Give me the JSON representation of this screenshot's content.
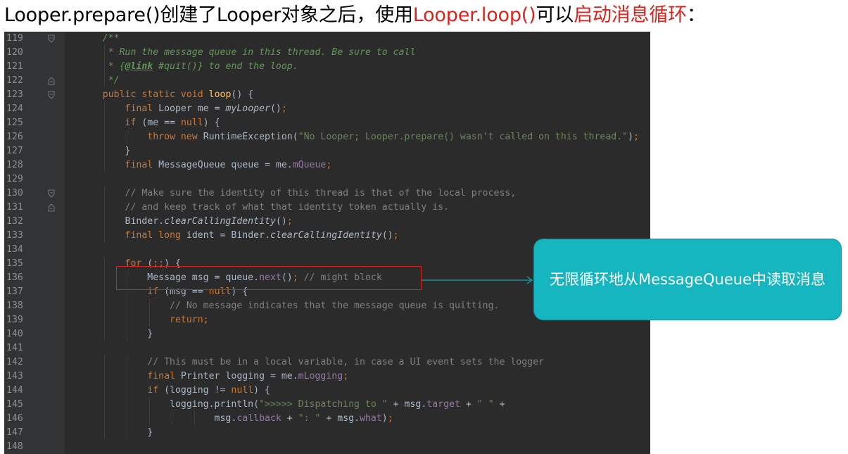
{
  "heading": {
    "part1": "Looper.prepare()创建了Looper对象之后，使用",
    "part2": "Looper.loop()",
    "part3": "可以",
    "part4": "启动消息循环",
    "part5": "："
  },
  "colors": {
    "heading_red": "#e0201b",
    "editor_bg": "#2b2b2b",
    "gutter_bg": "#313335",
    "highlight_border": "#d02424",
    "callout_bg": "#16b6c1",
    "connector": "#15a3ae"
  },
  "callout": {
    "text": "无限循环地从MessageQueue中读取消息"
  },
  "code": {
    "lines": [
      {
        "num": "119",
        "fold": "down",
        "segs": [
          {
            "t": "    "
          },
          {
            "c": "doc",
            "t": "/**"
          }
        ]
      },
      {
        "num": "120",
        "segs": [
          {
            "t": "     "
          },
          {
            "c": "doc",
            "t": "* Run the message queue in this thread. Be sure to call"
          }
        ]
      },
      {
        "num": "121",
        "segs": [
          {
            "t": "     "
          },
          {
            "c": "doc",
            "t": "* {"
          },
          {
            "c": "doctag",
            "t": "@link"
          },
          {
            "c": "doc",
            "t": " #quit()} to end the loop."
          }
        ]
      },
      {
        "num": "122",
        "fold": "up",
        "segs": [
          {
            "t": "     "
          },
          {
            "c": "doc",
            "t": "*/"
          }
        ]
      },
      {
        "num": "123",
        "fold": "down",
        "segs": [
          {
            "t": "    "
          },
          {
            "c": "kw",
            "t": "public static void "
          },
          {
            "c": "fn",
            "t": "loop"
          },
          {
            "t": "() {"
          }
        ]
      },
      {
        "num": "124",
        "segs": [
          {
            "t": "        "
          },
          {
            "c": "kw",
            "t": "final "
          },
          {
            "t": "Looper me = "
          },
          {
            "c": "it",
            "t": "myLooper"
          },
          {
            "t": "()"
          },
          {
            "c": "kw",
            "t": ";"
          }
        ]
      },
      {
        "num": "125",
        "segs": [
          {
            "t": "        "
          },
          {
            "c": "kw",
            "t": "if "
          },
          {
            "t": "(me == "
          },
          {
            "c": "kw",
            "t": "null"
          },
          {
            "t": ") {"
          }
        ]
      },
      {
        "num": "126",
        "segs": [
          {
            "t": "            "
          },
          {
            "c": "kw",
            "t": "throw new "
          },
          {
            "t": "RuntimeException("
          },
          {
            "c": "str",
            "t": "\"No Looper; Looper.prepare() wasn't called on this thread.\""
          },
          {
            "t": ")"
          },
          {
            "c": "kw",
            "t": ";"
          }
        ]
      },
      {
        "num": "127",
        "segs": [
          {
            "t": "        }"
          }
        ]
      },
      {
        "num": "128",
        "segs": [
          {
            "t": "        "
          },
          {
            "c": "kw",
            "t": "final "
          },
          {
            "t": "MessageQueue queue = me."
          },
          {
            "c": "fld",
            "t": "mQueue"
          },
          {
            "c": "kw",
            "t": ";"
          }
        ]
      },
      {
        "num": "129",
        "segs": []
      },
      {
        "num": "130",
        "fold": "down",
        "segs": [
          {
            "t": "        "
          },
          {
            "c": "cm",
            "t": "// Make sure the identity of this thread is that of the local process,"
          }
        ]
      },
      {
        "num": "131",
        "fold": "up",
        "segs": [
          {
            "t": "        "
          },
          {
            "c": "cm",
            "t": "// and keep track of what that identity token actually is."
          }
        ]
      },
      {
        "num": "132",
        "segs": [
          {
            "t": "        Binder."
          },
          {
            "c": "it",
            "t": "clearCallingIdentity"
          },
          {
            "t": "()"
          },
          {
            "c": "kw",
            "t": ";"
          }
        ]
      },
      {
        "num": "133",
        "segs": [
          {
            "t": "        "
          },
          {
            "c": "kw",
            "t": "final long "
          },
          {
            "t": "ident = Binder."
          },
          {
            "c": "it",
            "t": "clearCallingIdentity"
          },
          {
            "t": "()"
          },
          {
            "c": "kw",
            "t": ";"
          }
        ]
      },
      {
        "num": "134",
        "segs": []
      },
      {
        "num": "135",
        "segs": [
          {
            "t": "        "
          },
          {
            "c": "kw",
            "t": "for "
          },
          {
            "t": "("
          },
          {
            "c": "kw",
            "t": ";;"
          },
          {
            "t": ") {"
          }
        ]
      },
      {
        "num": "136",
        "segs": [
          {
            "t": "            Message msg = queue."
          },
          {
            "c": "fld",
            "t": "next"
          },
          {
            "t": "()"
          },
          {
            "c": "kw",
            "t": "; "
          },
          {
            "c": "cm",
            "t": "// might block"
          }
        ]
      },
      {
        "num": "137",
        "segs": [
          {
            "t": "            "
          },
          {
            "c": "kw",
            "t": "if "
          },
          {
            "t": "(msg == "
          },
          {
            "c": "kw",
            "t": "null"
          },
          {
            "t": ") {"
          }
        ]
      },
      {
        "num": "138",
        "segs": [
          {
            "t": "                "
          },
          {
            "c": "cm",
            "t": "// No message indicates that the message queue is quitting."
          }
        ]
      },
      {
        "num": "139",
        "segs": [
          {
            "t": "                "
          },
          {
            "c": "kw",
            "t": "return;"
          }
        ]
      },
      {
        "num": "140",
        "segs": [
          {
            "t": "            }"
          }
        ]
      },
      {
        "num": "141",
        "segs": []
      },
      {
        "num": "142",
        "segs": [
          {
            "t": "            "
          },
          {
            "c": "cm",
            "t": "// This must be in a local variable, in case a UI event sets the logger"
          }
        ]
      },
      {
        "num": "143",
        "segs": [
          {
            "t": "            "
          },
          {
            "c": "kw",
            "t": "final "
          },
          {
            "t": "Printer logging = me."
          },
          {
            "c": "fld",
            "t": "mLogging"
          },
          {
            "c": "kw",
            "t": ";"
          }
        ]
      },
      {
        "num": "144",
        "segs": [
          {
            "t": "            "
          },
          {
            "c": "kw",
            "t": "if "
          },
          {
            "t": "(logging != "
          },
          {
            "c": "kw",
            "t": "null"
          },
          {
            "t": ") {"
          }
        ]
      },
      {
        "num": "145",
        "segs": [
          {
            "t": "                logging.println("
          },
          {
            "c": "str",
            "t": "\">>>>> Dispatching to \""
          },
          {
            "t": " + msg."
          },
          {
            "c": "fld",
            "t": "target"
          },
          {
            "t": " + "
          },
          {
            "c": "str",
            "t": "\" \""
          },
          {
            "t": " +"
          }
        ]
      },
      {
        "num": "146",
        "segs": [
          {
            "t": "                        msg."
          },
          {
            "c": "fld",
            "t": "callback"
          },
          {
            "t": " + "
          },
          {
            "c": "str",
            "t": "\": \""
          },
          {
            "t": " + msg."
          },
          {
            "c": "fld",
            "t": "what"
          },
          {
            "t": ")"
          },
          {
            "c": "kw",
            "t": ";"
          }
        ]
      },
      {
        "num": "147",
        "segs": [
          {
            "t": "            }"
          }
        ]
      },
      {
        "num": "148",
        "segs": []
      }
    ]
  }
}
